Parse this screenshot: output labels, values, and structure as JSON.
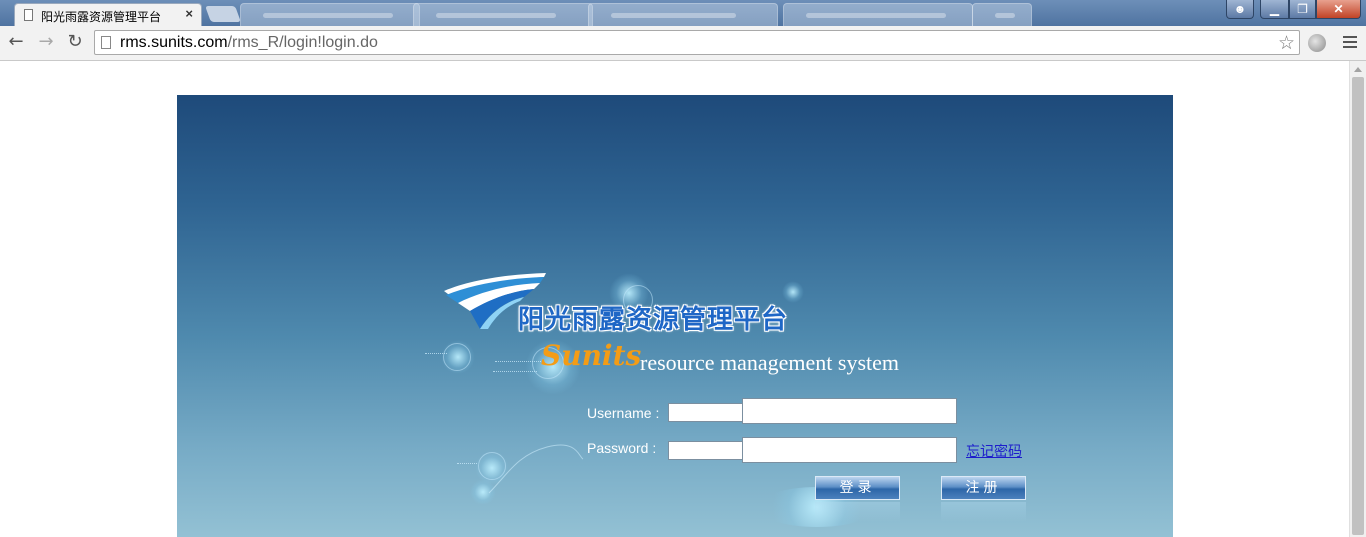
{
  "browser": {
    "tabs": [
      {
        "title": "阳光雨露资源管理平台",
        "active": true
      }
    ],
    "url_host": "rms.sunits.com",
    "url_path": "/rms_R/login!login.do",
    "close_glyph": "×",
    "window_buttons": {
      "user": "☻",
      "minimize": "▁",
      "maximize": "❐",
      "close": "✕"
    },
    "nav": {
      "back": "←",
      "forward": "→",
      "reload": "↻"
    },
    "star": "☆"
  },
  "login": {
    "title_cn": "阳光雨露资源管理平台",
    "brand": "Sunits",
    "tagline": "resource management system",
    "username_label": "Username :",
    "password_label": "Password  :",
    "forgot_password": "忘记密码",
    "login_button": "登录",
    "register_button": "注册",
    "username_value": "",
    "password_value": ""
  },
  "colors": {
    "panel_top": "#1e4a7a",
    "panel_bottom": "#93c1d4",
    "logo_blue": "#1f67c6",
    "brand_orange": "#f39c16"
  }
}
